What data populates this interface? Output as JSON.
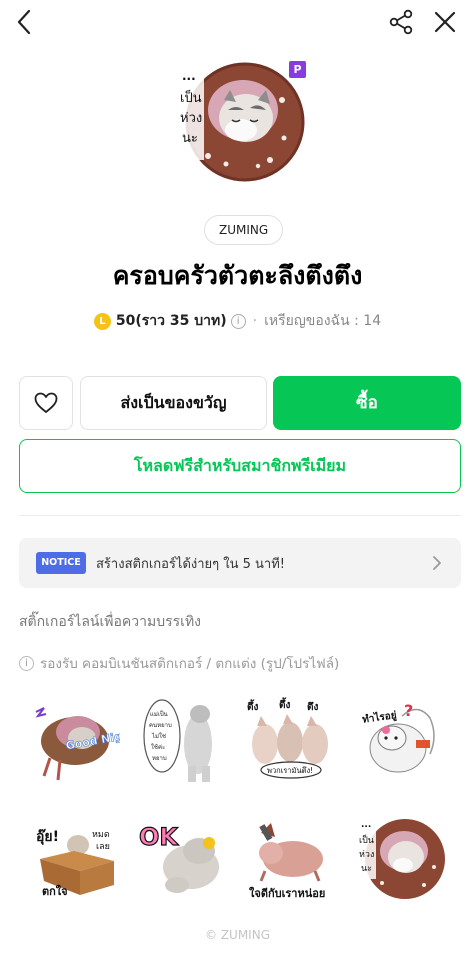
{
  "creator": "ZUMING",
  "title": "ครอบครัวตัวตะลึงตึงตึง",
  "price": {
    "coin_symbol": "L",
    "amount": "50(ราว 35 บาท)",
    "info_symbol": "i",
    "separator": "·",
    "my_coins": "เหรียญของฉัน : 14"
  },
  "premium_badge": "P",
  "actions": {
    "gift_label": "ส่งเป็นของขวัญ",
    "buy_label": "ซื้อ",
    "premium_label": "โหลดฟรีสำหรับสมาชิกพรีเมียม"
  },
  "notice": {
    "badge": "NOTICE",
    "text": "สร้างสติกเกอร์ได้ง่ายๆ ใน 5 นาที!"
  },
  "category": "สติ๊กเกอร์ไลน์เพื่อความบรรเทิง",
  "support_text": "รองรับ คอมบิเนชันสติกเกอร์ / ตกแต่ง (รูป/โปรไฟล์)",
  "sticker_captions": {
    "hero": [
      "...",
      "เป็น",
      "ห่วง",
      "นะ"
    ],
    "s1": "Good Night",
    "s2": [
      "แม่เป็น",
      "คนหยาบ",
      "ไม่ใช่",
      "ใช้ค่ะ",
      "หยาบ"
    ],
    "s3_top": [
      "ตึ้ง",
      "ตึ้ง",
      "ตึง"
    ],
    "s3_bottom": "พวกเรามันตึง!",
    "s4": "ทำไรอยู่",
    "s5_top": "อุ๊ย!",
    "s5_right": [
      "หมด",
      "เลย"
    ],
    "s5_bottom": "ตกใจ",
    "s6": "OK",
    "s7": "ใจดีกับเราหน่อย",
    "s8": [
      "...",
      "เป็น",
      "ห่วง",
      "นะ"
    ]
  },
  "footer": "© ZUMING",
  "colors": {
    "accent_green": "#06c755",
    "notice_blue": "#4e6ce6",
    "premium_purple": "#8a3be0",
    "coin_gold": "#f4c21a"
  }
}
